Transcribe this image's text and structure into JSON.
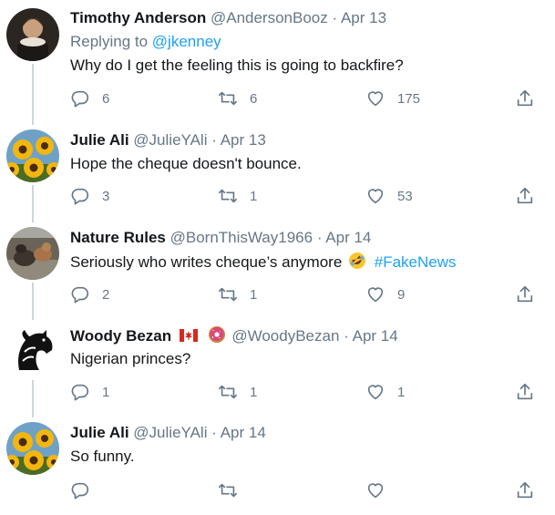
{
  "tweets": [
    {
      "name": "Timothy Anderson",
      "handle": "@AndersonBooz",
      "separator": "·",
      "date": "Apr 13",
      "replying_prefix": "Replying to",
      "replying_to": "@jkenney",
      "text": "Why do I get the feeling this is going to backfire?",
      "replies": "6",
      "retweets": "6",
      "likes": "175"
    },
    {
      "name": "Julie Ali",
      "handle": "@JulieYAli",
      "separator": "·",
      "date": "Apr 13",
      "text": "Hope the cheque doesn't bounce.",
      "replies": "3",
      "retweets": "1",
      "likes": "53"
    },
    {
      "name": "Nature Rules",
      "handle": "@BornThisWay1966",
      "separator": "·",
      "date": "Apr 14",
      "text": "Seriously who writes cheque’s anymore",
      "emoji": "rolling-on-floor-laughing-emoji",
      "hashtag": "#FakeNews",
      "replies": "2",
      "retweets": "1",
      "likes": "9"
    },
    {
      "name": "Woody Bezan",
      "name_emojis": [
        "canada-flag-emoji",
        "donut-emoji"
      ],
      "handle": "@WoodyBezan",
      "separator": "·",
      "date": "Apr 14",
      "text": "Nigerian princes?",
      "replies": "1",
      "retweets": "1",
      "likes": "1"
    },
    {
      "name": "Julie Ali",
      "handle": "@JulieYAli",
      "separator": "·",
      "date": "Apr 14",
      "text": "So funny.",
      "replies": "",
      "retweets": "",
      "likes": ""
    }
  ],
  "icons": {
    "reply": "reply-icon",
    "retweet": "retweet-icon",
    "like": "heart-icon",
    "share": "share-icon"
  },
  "colors": {
    "text": "#14171a",
    "muted": "#657786",
    "link": "#1da1f2",
    "thread_line": "#ccd6dd"
  }
}
